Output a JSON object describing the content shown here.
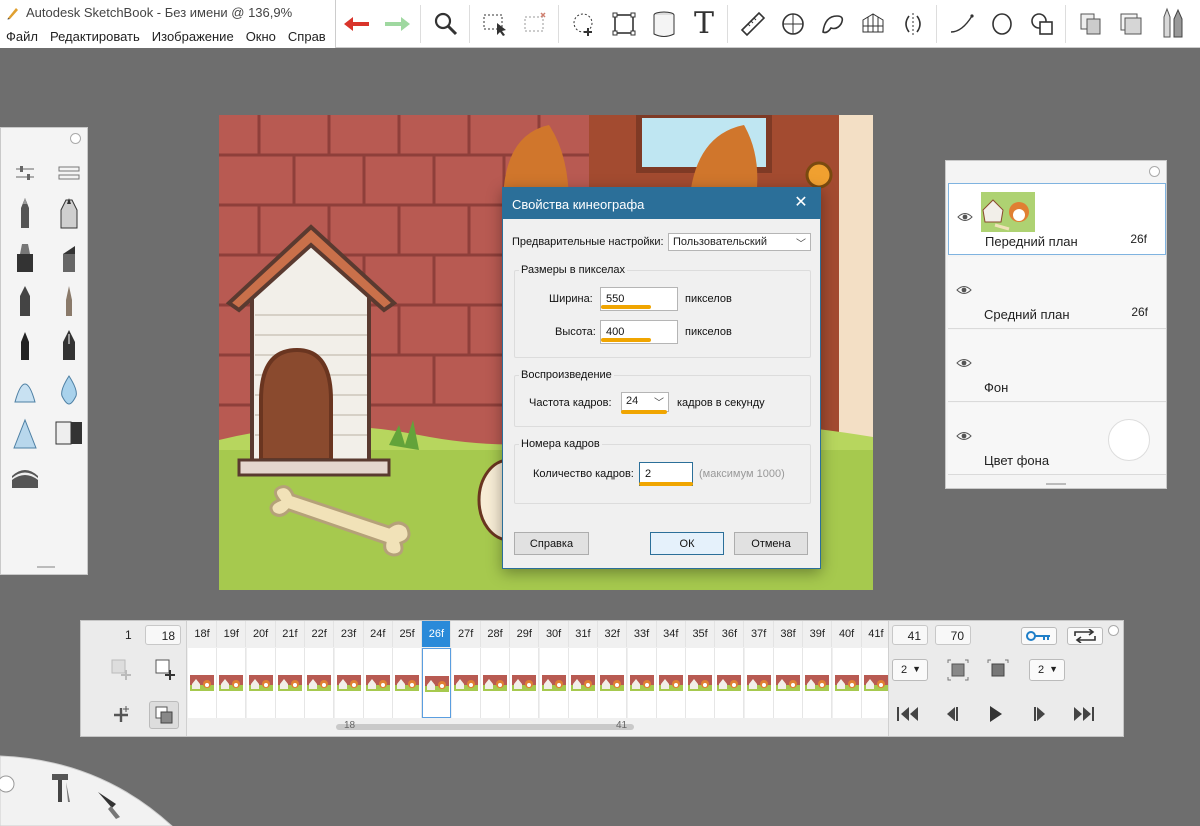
{
  "window": {
    "title": "Autodesk SketchBook - Без имени @ 136,9%",
    "menu": [
      "Файл",
      "Редактировать",
      "Изображение",
      "Окно",
      "Справ"
    ]
  },
  "toolbar": {
    "tools": [
      "undo-icon",
      "redo-icon",
      "zoom-icon",
      "select-icon",
      "crop-icon",
      "transform-icon",
      "distort-icon",
      "fill-icon",
      "text-icon",
      "ruler-icon",
      "ellipse-guide-icon",
      "french-curve-icon",
      "perspective-icon",
      "symmetry-icon",
      "stroke-icon",
      "shape-icon",
      "copy-icon",
      "layers-icon",
      "brush-palette-icon"
    ],
    "text_tool_glyph": "T"
  },
  "dialog": {
    "title": "Свойства кинеографа",
    "close": "✕",
    "presets_label": "Предварительные настройки:",
    "presets_value": "Пользовательский",
    "pixel_group": "Размеры в пикселах",
    "width_label": "Ширина:",
    "width_value": "550",
    "width_unit": "пикселов",
    "height_label": "Высота:",
    "height_value": "400",
    "height_unit": "пикселов",
    "playback_group": "Воспроизведение",
    "fps_label": "Частота кадров:",
    "fps_value": "24",
    "fps_unit": "кадров в секунду",
    "frames_group": "Номера кадров",
    "frames_label": "Количество кадров:",
    "frames_value": "2",
    "frames_hint": "(максимум 1000)",
    "help_button": "Справка",
    "ok_button": "ОК",
    "cancel_button": "Отмена",
    "highlight_color": "#f0a500"
  },
  "layers": [
    {
      "name": "Передний план",
      "frames": "26f",
      "selected": true
    },
    {
      "name": "Средний план",
      "frames": "26f",
      "selected": false
    },
    {
      "name": "Фон",
      "frames": "",
      "selected": false
    },
    {
      "name": "Цвет фона",
      "frames": "",
      "selected": false
    }
  ],
  "timeline": {
    "start_frame": "1",
    "current_frame": "18",
    "frames": [
      "18f",
      "19f",
      "20f",
      "21f",
      "22f",
      "23f",
      "24f",
      "25f",
      "26f",
      "27f",
      "28f",
      "29f",
      "30f",
      "31f",
      "32f",
      "33f",
      "34f",
      "35f",
      "36f",
      "37f",
      "38f",
      "39f",
      "40f",
      "41f"
    ],
    "active_frame": "26f",
    "end_view_frame": "41",
    "total_frames": "70",
    "scroll_start": "18",
    "scroll_end": "41",
    "step_left": "2",
    "step_right": "2",
    "accent": "#2a8ad9"
  }
}
